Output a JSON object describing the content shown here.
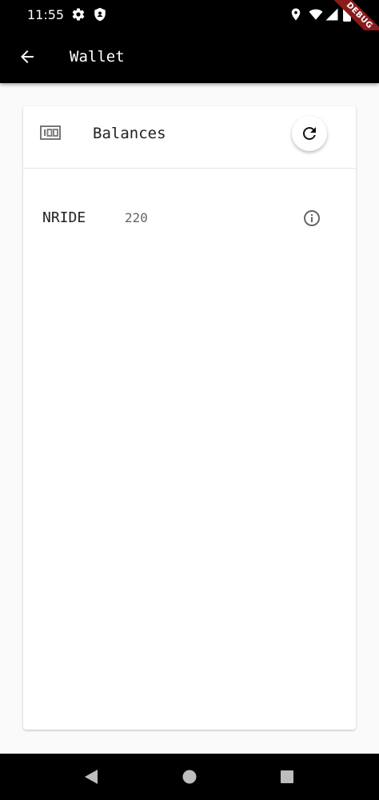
{
  "status_bar": {
    "time": "11:55",
    "debug_label": "DEBUG",
    "icons": [
      "gear-icon",
      "shield-icon",
      "location-icon",
      "wifi-icon",
      "signal-icon",
      "battery-icon"
    ]
  },
  "app_bar": {
    "title": "Wallet",
    "back_icon": "arrow-back-icon"
  },
  "card": {
    "header": {
      "icon": "money-icon",
      "title": "Balances",
      "refresh_icon": "refresh-icon"
    },
    "balances": [
      {
        "symbol": "NRIDE",
        "amount": "220",
        "info_icon": "info-icon"
      }
    ]
  },
  "nav_bar": {
    "icons": [
      "back-triangle-icon",
      "home-circle-icon",
      "recents-square-icon"
    ]
  },
  "colors": {
    "bar_background": "#000000",
    "page_background": "#fafafa",
    "card_background": "#ffffff",
    "debug_ribbon": "#8b1c1c"
  }
}
